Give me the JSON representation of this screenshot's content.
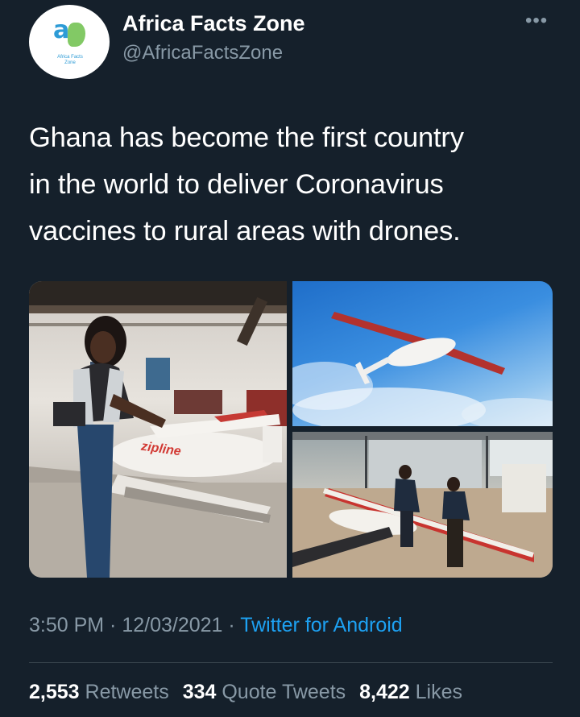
{
  "author": {
    "display_name": "Africa Facts Zone",
    "handle": "@AfricaFactsZone",
    "avatar_glyph": "a",
    "avatar_caption": "Africa Facts Zone"
  },
  "more_icon": "more-horizontal-icon",
  "tweet": {
    "line1": "Ghana has become the first country",
    "line2": "in the world to deliver Coronavirus",
    "line3": "vaccines to rural areas with drones."
  },
  "media": {
    "drone_brand": "zipline"
  },
  "meta": {
    "time": "3:50 PM",
    "sep1": " · ",
    "date": "12/03/2021",
    "sep2": " · ",
    "source": "Twitter for Android"
  },
  "stats": {
    "retweets_count": "2,553",
    "retweets_label": "Retweets",
    "quotes_count": "334",
    "quotes_label": "Quote Tweets",
    "likes_count": "8,422",
    "likes_label": "Likes"
  },
  "colors": {
    "background": "#15202b",
    "secondary_text": "#8899a6",
    "link": "#1da1f2",
    "divider": "#38444d"
  }
}
